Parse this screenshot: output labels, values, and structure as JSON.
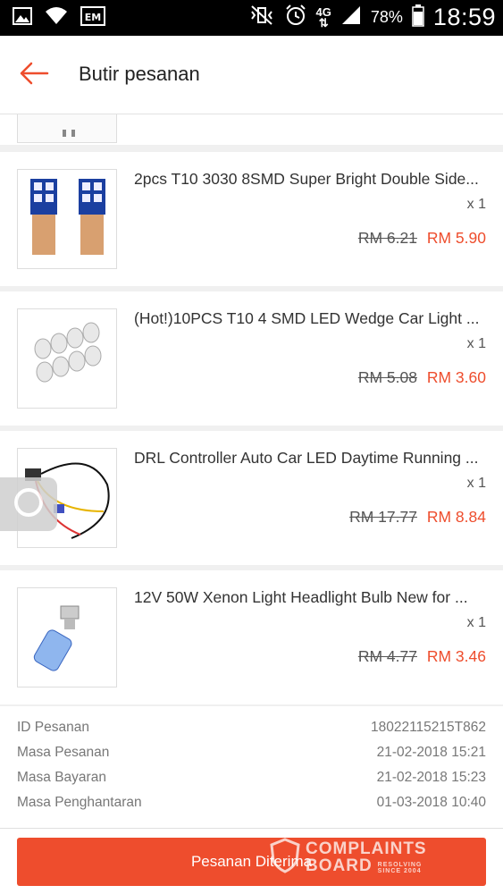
{
  "status_bar": {
    "network": "4G",
    "battery": "78%",
    "time": "18:59",
    "icons": [
      "image-icon",
      "wifi-icon",
      "em-icon",
      "mute-vibrate-icon",
      "alarm-icon",
      "signal-icon",
      "battery-icon"
    ]
  },
  "header": {
    "title": "Butir pesanan",
    "back_icon": "arrow-left-icon"
  },
  "colors": {
    "accent": "#ee4d2d",
    "background": "#f0f0f0"
  },
  "products": [
    {
      "name": "2pcs T10 3030 8SMD Super Bright Double Side...",
      "qty": "x 1",
      "original_price": "RM 6.21",
      "price": "RM 5.90"
    },
    {
      "name": "(Hot!)10PCS T10 4 SMD LED Wedge Car Light ...",
      "qty": "x 1",
      "original_price": "RM 5.08",
      "price": "RM 3.60"
    },
    {
      "name": "DRL Controller Auto Car LED Daytime Running ...",
      "qty": "x 1",
      "original_price": "RM 17.77",
      "price": "RM 8.84"
    },
    {
      "name": "12V 50W Xenon Light Headlight Bulb New for ...",
      "qty": "x 1",
      "original_price": "RM 4.77",
      "price": "RM 3.46"
    }
  ],
  "order_info": [
    {
      "label": "ID Pesanan",
      "value": "18022115215T862"
    },
    {
      "label": "Masa Pesanan",
      "value": "21-02-2018 15:21"
    },
    {
      "label": "Masa Bayaran",
      "value": "21-02-2018 15:23"
    },
    {
      "label": "Masa Penghantaran",
      "value": "01-03-2018 10:40"
    }
  ],
  "footer": {
    "confirm_label": "Pesanan Diterima"
  },
  "watermark": {
    "line1": "COMPLAINTS",
    "line2": "BOARD",
    "line3": "RESOLVING",
    "line4": "SINCE 2004"
  }
}
